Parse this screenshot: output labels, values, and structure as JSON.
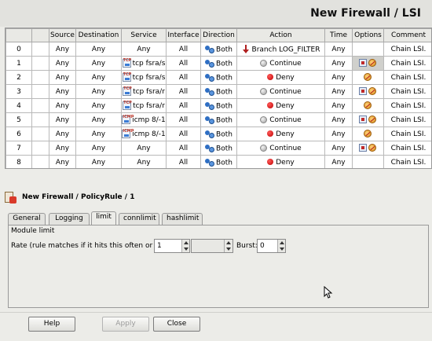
{
  "window": {
    "title": "New Firewall / LSI"
  },
  "table": {
    "columns": [
      "",
      "Source",
      "Destination",
      "Service",
      "Interface",
      "Direction",
      "Action",
      "Time",
      "Options",
      "Comment"
    ],
    "rows": [
      {
        "idx": "0",
        "source": "Any",
        "destination": "Any",
        "service": "Any",
        "service_icon": "",
        "interface": "All",
        "direction": "Both",
        "action": "Branch LOG_FILTER",
        "action_icon": "branch",
        "time": "Any",
        "options": [],
        "options_selected": false,
        "comment": "Chain LSI."
      },
      {
        "idx": "1",
        "source": "Any",
        "destination": "Any",
        "service": "tcp fsra/s",
        "service_icon": "tcp",
        "interface": "All",
        "direction": "Both",
        "action": "Continue",
        "action_icon": "continue",
        "time": "Any",
        "options": [
          "log-icon",
          "limit-icon"
        ],
        "options_selected": true,
        "comment": "Chain LSI."
      },
      {
        "idx": "2",
        "source": "Any",
        "destination": "Any",
        "service": "tcp fsra/s",
        "service_icon": "tcp",
        "interface": "All",
        "direction": "Both",
        "action": "Deny",
        "action_icon": "deny",
        "time": "Any",
        "options": [
          "limit-icon"
        ],
        "options_selected": false,
        "comment": "Chain LSI."
      },
      {
        "idx": "3",
        "source": "Any",
        "destination": "Any",
        "service": "tcp fsra/r",
        "service_icon": "tcp",
        "interface": "All",
        "direction": "Both",
        "action": "Continue",
        "action_icon": "continue",
        "time": "Any",
        "options": [
          "log-icon",
          "limit-icon"
        ],
        "options_selected": false,
        "comment": "Chain LSI."
      },
      {
        "idx": "4",
        "source": "Any",
        "destination": "Any",
        "service": "tcp fsra/r",
        "service_icon": "tcp",
        "interface": "All",
        "direction": "Both",
        "action": "Deny",
        "action_icon": "deny",
        "time": "Any",
        "options": [
          "limit-icon"
        ],
        "options_selected": false,
        "comment": "Chain LSI."
      },
      {
        "idx": "5",
        "source": "Any",
        "destination": "Any",
        "service": "icmp 8/-1",
        "service_icon": "icmp",
        "interface": "All",
        "direction": "Both",
        "action": "Continue",
        "action_icon": "continue",
        "time": "Any",
        "options": [
          "log-icon",
          "limit-icon"
        ],
        "options_selected": false,
        "comment": "Chain LSI."
      },
      {
        "idx": "6",
        "source": "Any",
        "destination": "Any",
        "service": "icmp 8/-1",
        "service_icon": "icmp",
        "interface": "All",
        "direction": "Both",
        "action": "Deny",
        "action_icon": "deny",
        "time": "Any",
        "options": [
          "limit-icon"
        ],
        "options_selected": false,
        "comment": "Chain LSI."
      },
      {
        "idx": "7",
        "source": "Any",
        "destination": "Any",
        "service": "Any",
        "service_icon": "",
        "interface": "All",
        "direction": "Both",
        "action": "Continue",
        "action_icon": "continue",
        "time": "Any",
        "options": [
          "log-icon",
          "limit-icon"
        ],
        "options_selected": false,
        "comment": "Chain LSI."
      },
      {
        "idx": "8",
        "source": "Any",
        "destination": "Any",
        "service": "Any",
        "service_icon": "",
        "interface": "All",
        "direction": "Both",
        "action": "Deny",
        "action_icon": "deny",
        "time": "Any",
        "options": [],
        "options_selected": false,
        "comment": "Chain LSI."
      }
    ]
  },
  "policy": {
    "title": "New Firewall / PolicyRule / 1"
  },
  "tabs": [
    {
      "label": "General",
      "active": false
    },
    {
      "label": "Logging",
      "active": false
    },
    {
      "label": "limit",
      "active": true
    },
    {
      "label": "connlimit",
      "active": false
    },
    {
      "label": "hashlimit",
      "active": false
    }
  ],
  "limit_panel": {
    "section": "Module limit",
    "rate_label": "Rate (rule matches if it hits this often or less):",
    "rate_value": "1",
    "rate_unit": "",
    "burst_label": "Burst:",
    "burst_value": "0"
  },
  "buttons": {
    "help": "Help",
    "apply": "Apply",
    "close": "Close"
  }
}
